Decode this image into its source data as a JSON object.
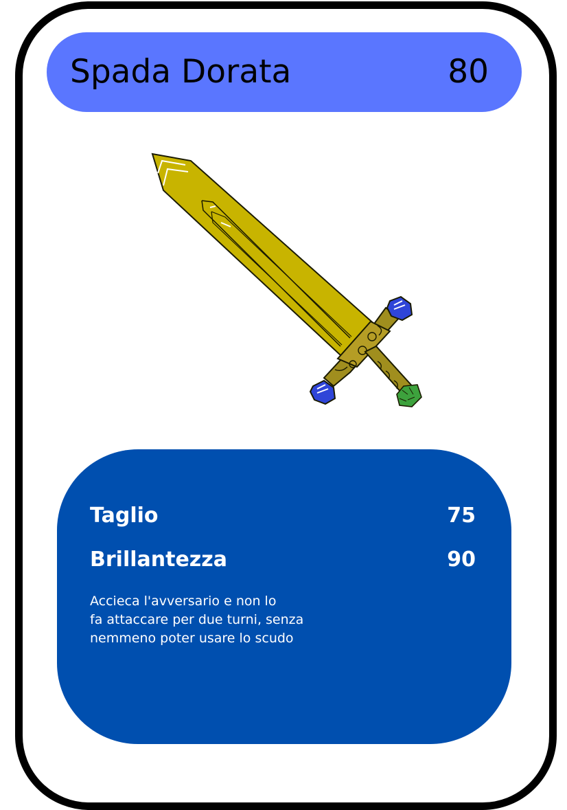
{
  "card": {
    "name": "Spada Dorata",
    "cost": "80",
    "art_icon": "golden-sword-icon",
    "stats": [
      {
        "label": "Taglio",
        "value": "75"
      },
      {
        "label": "Brillantezza",
        "value": "90"
      }
    ],
    "description_lines": [
      "Accieca l'avversario e non lo",
      "fa attaccare per due turni, senza",
      "nemmeno poter usare lo scudo"
    ]
  },
  "colors": {
    "border": "#000000",
    "title_bar": "#5a76ff",
    "stats_panel": "#004faf",
    "blade": "#c8b400",
    "hilt": "#a08e1e",
    "gem": "#2f45d8",
    "grip_gem": "#3da23d"
  }
}
